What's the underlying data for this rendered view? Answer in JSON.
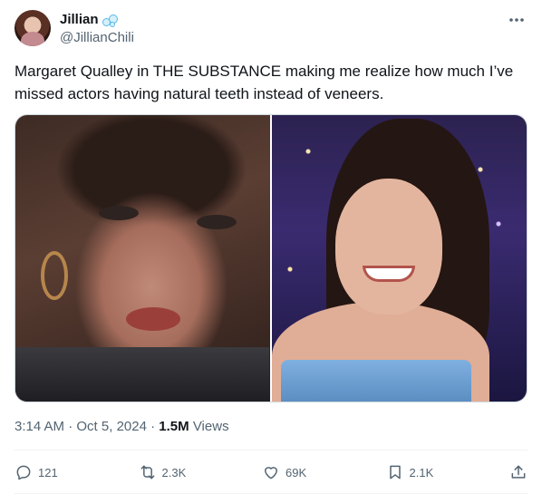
{
  "author": {
    "display_name": "Jillian",
    "handle": "@JillianChili"
  },
  "tweet": {
    "text": "Margaret Qualley in THE SUBSTANCE making me realize how much I’ve missed actors having natural teeth instead of veneers."
  },
  "meta": {
    "time": "3:14 AM",
    "separator1": " · ",
    "date": "Oct 5, 2024",
    "separator2": " · ",
    "views_count": "1.5M",
    "views_label": " Views"
  },
  "actions": {
    "replies": "121",
    "reposts": "2.3K",
    "likes": "69K",
    "bookmarks": "2.1K"
  },
  "icons": {
    "more": "more-horizontal-icon",
    "reply": "reply-icon",
    "repost": "repost-icon",
    "like": "heart-icon",
    "bookmark": "bookmark-icon",
    "share": "share-icon",
    "emoji": "bubbles-emoji-icon"
  },
  "colors": {
    "text_primary": "#0f1419",
    "text_secondary": "#536471",
    "border": "#cfd9de",
    "divider": "#eff3f4",
    "emoji_blue": "#5ab8e8"
  }
}
